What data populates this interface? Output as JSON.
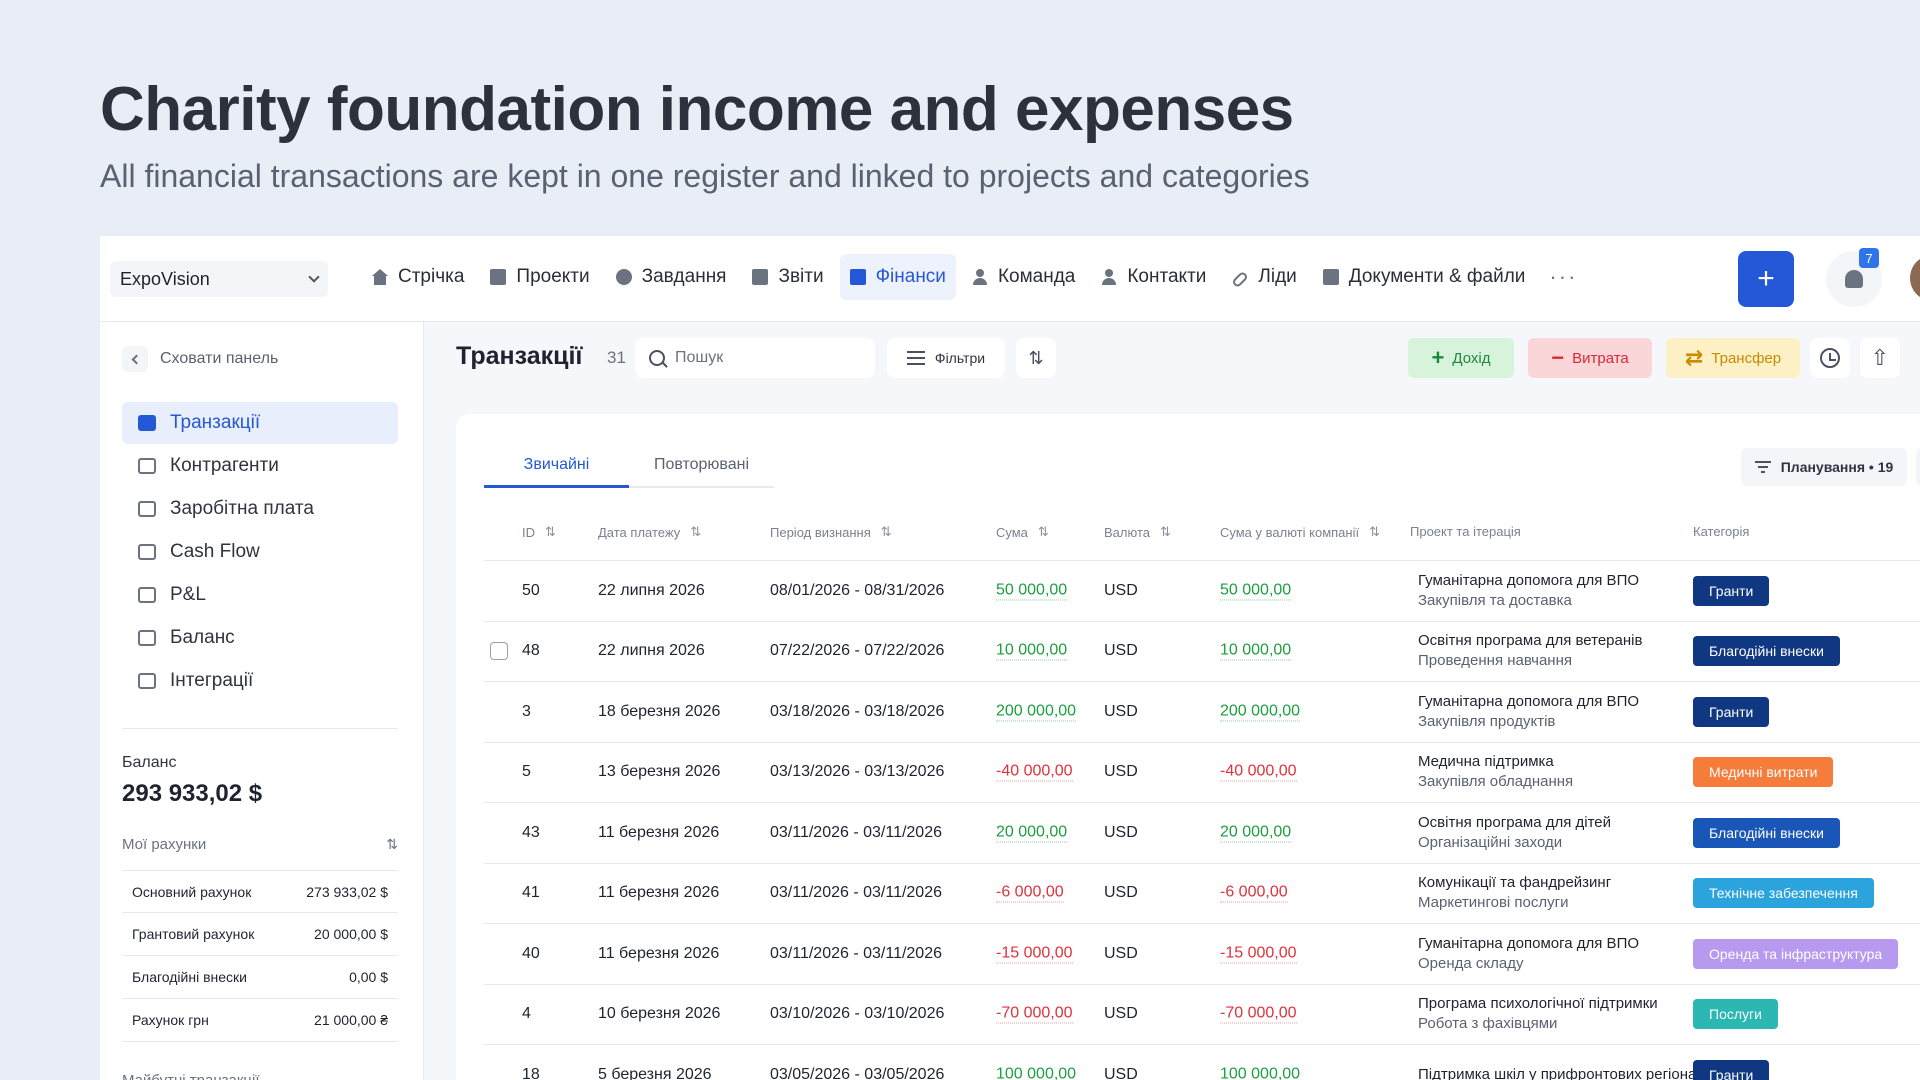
{
  "hero": {
    "title": "Charity foundation income and expenses",
    "subtitle": "All financial transactions are kept in one register and linked to projects and categories"
  },
  "topnav": {
    "org": "ExpoVision",
    "items": [
      {
        "label": "Стрічка",
        "icon": "home-icon"
      },
      {
        "label": "Проекти",
        "icon": "document-icon"
      },
      {
        "label": "Завдання",
        "icon": "check-circle-icon"
      },
      {
        "label": "Звіти",
        "icon": "report-icon"
      },
      {
        "label": "Фінанси",
        "icon": "finance-icon"
      },
      {
        "label": "Команда",
        "icon": "person-icon"
      },
      {
        "label": "Контакти",
        "icon": "contacts-icon"
      },
      {
        "label": "Ліди",
        "icon": "link-icon"
      },
      {
        "label": "Документи & файли",
        "icon": "files-icon"
      }
    ],
    "active": "Фінанси",
    "more": "···",
    "plus": "+",
    "notifications": "7"
  },
  "sidebar": {
    "hide_label": "Сховати панель",
    "items": [
      {
        "label": "Транзакції",
        "icon": "card-icon"
      },
      {
        "label": "Контрагенти",
        "icon": "handshake-icon"
      },
      {
        "label": "Заробітна плата",
        "icon": "briefcase-icon"
      },
      {
        "label": "Cash Flow",
        "icon": "bar-chart-icon"
      },
      {
        "label": "P&L",
        "icon": "calendar-icon"
      },
      {
        "label": "Баланс",
        "icon": "bank-icon"
      },
      {
        "label": "Інтеграції",
        "icon": "sync-icon"
      }
    ],
    "balance_label": "Баланс",
    "balance_value": "293 933,02 $",
    "accounts_label": "Мої рахунки",
    "accounts": [
      {
        "name": "Основний рахунок",
        "value": "273 933,02 $"
      },
      {
        "name": "Грантовий рахунок",
        "value": "20 000,00 $"
      },
      {
        "name": "Благодійні внески",
        "value": "0,00 $"
      },
      {
        "name": "Рахунок грн",
        "value": "21 000,00 ₴"
      }
    ],
    "future_label": "Майбутні транзакції"
  },
  "content": {
    "title": "Транзакції",
    "count": "31",
    "search_placeholder": "Пошук",
    "filters_label": "Фільтри",
    "income_label": "Дохід",
    "expense_label": "Витрата",
    "transfer_label": "Трансфер",
    "tabs": [
      "Звичайні",
      "Повторювані"
    ],
    "planning_label": "Планування • 19",
    "columns": [
      "ID",
      "Дата платежу",
      "Період визнання",
      "Сума",
      "Валюта",
      "Сума у валюті компанії",
      "Проект та ітерація",
      "Категорія"
    ],
    "rows": [
      {
        "id": "50",
        "date": "22 липня 2026",
        "period": "08/01/2026 - 08/31/2026",
        "amount": "50 000,00",
        "currency": "USD",
        "company_amount": "50 000,00",
        "project": "Гуманітарна допомога для ВПО",
        "iteration": "Закупівля та доставка",
        "category": "Гранти",
        "cat_color": "#0f3782",
        "sign": "pos",
        "checkbox": false
      },
      {
        "id": "48",
        "date": "22 липня 2026",
        "period": "07/22/2026 - 07/22/2026",
        "amount": "10 000,00",
        "currency": "USD",
        "company_amount": "10 000,00",
        "project": "Освітня програма для ветеранів",
        "iteration": "Проведення навчання",
        "category": "Благодійні внески",
        "cat_color": "#0f3782",
        "sign": "pos",
        "checkbox": true
      },
      {
        "id": "3",
        "date": "18 березня 2026",
        "period": "03/18/2026 - 03/18/2026",
        "amount": "200 000,00",
        "currency": "USD",
        "company_amount": "200 000,00",
        "project": "Гуманітарна допомога для ВПО",
        "iteration": "Закупівля продуктів",
        "category": "Гранти",
        "cat_color": "#0f3782",
        "sign": "pos",
        "checkbox": false
      },
      {
        "id": "5",
        "date": "13 березня 2026",
        "period": "03/13/2026 - 03/13/2026",
        "amount": "-40 000,00",
        "currency": "USD",
        "company_amount": "-40 000,00",
        "project": "Медична підтримка",
        "iteration": "Закупівля обладнання",
        "category": "Медичні витрати",
        "cat_color": "#f57c3a",
        "sign": "neg",
        "checkbox": false
      },
      {
        "id": "43",
        "date": "11 березня 2026",
        "period": "03/11/2026 - 03/11/2026",
        "amount": "20 000,00",
        "currency": "USD",
        "company_amount": "20 000,00",
        "project": "Освітня програма для дітей",
        "iteration": "Організаційні заходи",
        "category": "Благодійні внески",
        "cat_color": "#1a55b8",
        "sign": "pos",
        "checkbox": false
      },
      {
        "id": "41",
        "date": "11 березня 2026",
        "period": "03/11/2026 - 03/11/2026",
        "amount": "-6 000,00",
        "currency": "USD",
        "company_amount": "-6 000,00",
        "project": "Комунікації та фандрейзинг",
        "iteration": "Маркетингові послуги",
        "category": "Технічне забезпечення",
        "cat_color": "#2ba3dd",
        "sign": "neg",
        "checkbox": false
      },
      {
        "id": "40",
        "date": "11 березня 2026",
        "period": "03/11/2026 - 03/11/2026",
        "amount": "-15 000,00",
        "currency": "USD",
        "company_amount": "-15 000,00",
        "project": "Гуманітарна допомога для ВПО",
        "iteration": "Оренда складу",
        "category": "Оренда та інфраструктура",
        "cat_color": "#b79af0",
        "sign": "neg",
        "checkbox": false
      },
      {
        "id": "4",
        "date": "10 березня 2026",
        "period": "03/10/2026 - 03/10/2026",
        "amount": "-70 000,00",
        "currency": "USD",
        "company_amount": "-70 000,00",
        "project": "Програма психологічної підтримки",
        "iteration": "Робота з фахівцями",
        "category": "Послуги",
        "cat_color": "#2bb8b3",
        "sign": "neg",
        "checkbox": false
      },
      {
        "id": "18",
        "date": "5 березня 2026",
        "period": "03/05/2026 - 03/05/2026",
        "amount": "100 000,00",
        "currency": "USD",
        "company_amount": "100 000,00",
        "project": "Підтримка шкіл у прифронтових регіонах",
        "iteration": "",
        "category": "Гранти",
        "cat_color": "#0f3782",
        "sign": "pos",
        "checkbox": false
      }
    ]
  }
}
